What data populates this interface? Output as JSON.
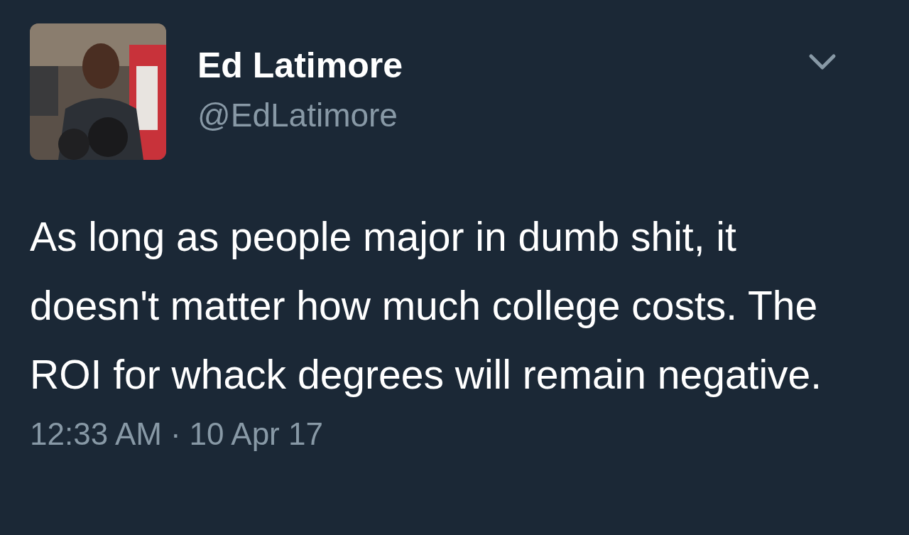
{
  "author": {
    "name": "Ed Latimore",
    "handle": "@EdLatimore"
  },
  "tweet": {
    "text": "As long as people major in dumb shit, it doesn't matter how much college costs. The ROI for whack degrees will remain negative.",
    "time": "12:33 AM",
    "separator": "·",
    "date": "10 Apr 17"
  }
}
